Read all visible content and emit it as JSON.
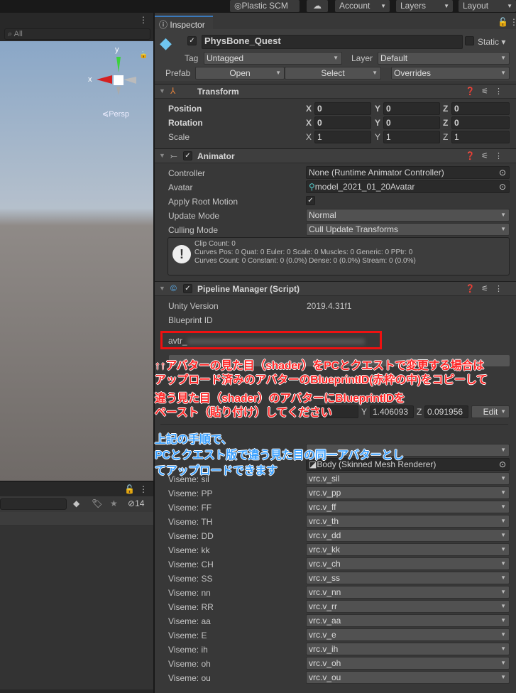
{
  "toolbar": {
    "plastic": "Plastic SCM",
    "account": "Account",
    "layers": "Layers",
    "layout": "Layout"
  },
  "scene": {
    "search_placeholder": "All",
    "persp": "Persp",
    "gizmo_y": "y",
    "gizmo_x": "x"
  },
  "project": {
    "hidden_count": "14"
  },
  "inspector": {
    "tab": "Inspector",
    "object_name": "PhysBone_Quest",
    "static_label": "Static",
    "tag_label": "Tag",
    "tag_value": "Untagged",
    "layer_label": "Layer",
    "layer_value": "Default",
    "prefab_label": "Prefab",
    "open": "Open",
    "select": "Select",
    "overrides": "Overrides",
    "transform": {
      "title": "Transform",
      "position": "Position",
      "rotation": "Rotation",
      "scale": "Scale",
      "pos": [
        "0",
        "0",
        "0"
      ],
      "rot": [
        "0",
        "0",
        "0"
      ],
      "scl": [
        "1",
        "1",
        "1"
      ],
      "x": "X",
      "y": "Y",
      "z": "Z"
    },
    "animator": {
      "title": "Animator",
      "controller_label": "Controller",
      "controller": "None (Runtime Animator Controller)",
      "avatar_label": "Avatar",
      "avatar": "model_2021_01_20Avatar",
      "root_motion": "Apply Root Motion",
      "update_label": "Update Mode",
      "update": "Normal",
      "culling_label": "Culling Mode",
      "culling": "Cull Update Transforms",
      "info": [
        "Clip Count: 0",
        "Curves Pos: 0 Quat: 0 Euler: 0 Scale: 0 Muscles: 0 Generic: 0 PPtr: 0",
        "Curves Count: 0 Constant: 0 (0.0%) Dense: 0 (0.0%) Stream: 0 (0.0%)"
      ]
    },
    "pipeline": {
      "title": "Pipeline Manager (Script)",
      "unity_label": "Unity Version",
      "unity": "2019.4.31f1",
      "blueprint_label": "Blueprint ID",
      "blueprint": "avtr_"
    },
    "view": {
      "y": "1.406093",
      "z": "0.091956",
      "edit": "Edit"
    },
    "body": "Body (Skinned Mesh Renderer)",
    "visemes": [
      [
        "Viseme: sil",
        "vrc.v_sil"
      ],
      [
        "Viseme: PP",
        "vrc.v_pp"
      ],
      [
        "Viseme: FF",
        "vrc.v_ff"
      ],
      [
        "Viseme: TH",
        "vrc.v_th"
      ],
      [
        "Viseme: DD",
        "vrc.v_dd"
      ],
      [
        "Viseme: kk",
        "vrc.v_kk"
      ],
      [
        "Viseme: CH",
        "vrc.v_ch"
      ],
      [
        "Viseme: SS",
        "vrc.v_ss"
      ],
      [
        "Viseme: nn",
        "vrc.v_nn"
      ],
      [
        "Viseme: RR",
        "vrc.v_rr"
      ],
      [
        "Viseme: aa",
        "vrc.v_aa"
      ],
      [
        "Viseme: E",
        "vrc.v_e"
      ],
      [
        "Viseme: ih",
        "vrc.v_ih"
      ],
      [
        "Viseme: oh",
        "vrc.v_oh"
      ],
      [
        "Viseme: ou",
        "vrc.v_ou"
      ]
    ]
  },
  "annotation": {
    "red": [
      "↑↑アバターの見た目（shader）をPCとクエストで変更する場合は",
      "アップロード済みのアバターのBlueprintID(赤枠の中)をコピーして",
      "違う見た目（shader）のアバターにBlueprintIDを",
      "ペースト（貼り付け）してください"
    ],
    "blue": [
      "上記の手順で、",
      "PCとクエスト版で違う見た目の同一アバターとし",
      "てアップロードできます"
    ]
  }
}
